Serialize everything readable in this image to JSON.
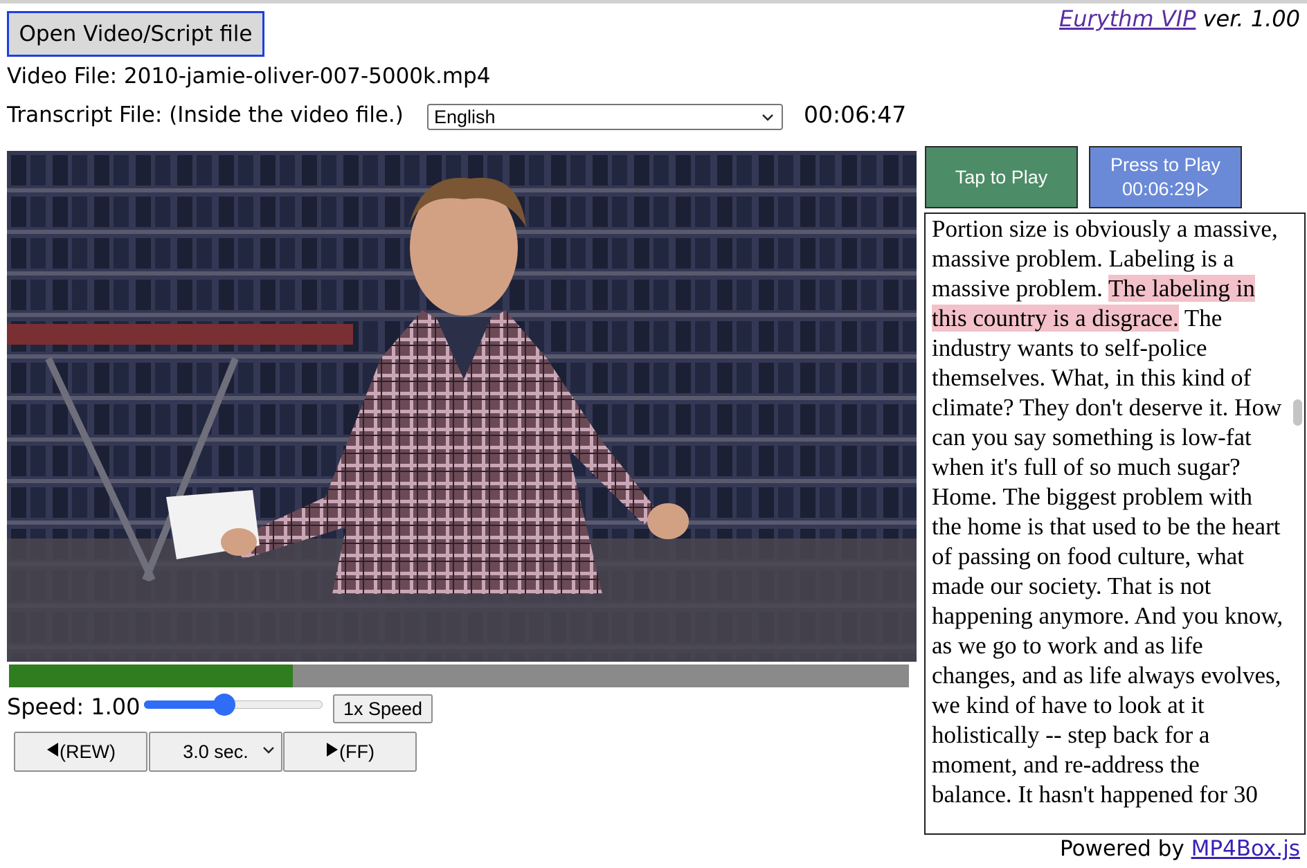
{
  "header": {
    "open_button": "Open Video/Script file",
    "brand_name": "Eurythm VIP",
    "brand_version": "ver. 1.00",
    "video_file_label": "Video File:",
    "video_file_name": "2010-jamie-oliver-007-5000k.mp4",
    "transcript_file_label": "Transcript File:",
    "transcript_file_value": "(Inside the video file.)",
    "language_selected": "English",
    "current_time": "00:06:47"
  },
  "player": {
    "progress_fraction": 0.315,
    "speed_label": "Speed:",
    "speed_value": "1.00",
    "speed_slider_fraction": 0.45,
    "speed_reset_button": "1x Speed",
    "rewind_button": "(REW)",
    "step_selected": "3.0 sec.",
    "fastforward_button": "(FF)"
  },
  "actions": {
    "tap_button": "Tap to Play",
    "press_button_line1": "Press to Play",
    "press_button_time": "00:06:29"
  },
  "transcript": {
    "before": "Portion size is obviously a massive, massive problem. Labeling is a massive problem. ",
    "highlight": "The labeling in this country is a disgrace.",
    "after": " The industry wants to self-police themselves. What, in this kind of climate? They don't deserve it. How can you say something is low-fat when it's full of so much sugar? Home. The biggest problem with the home is that used to be the heart of passing on food culture, what made our society. That is not happening anymore. And you know, as we go to work and as life changes, and as life always evolves, we kind of have to look at it holistically -- step back for a moment, and re-address the balance. It hasn't happened for 30"
  },
  "footer": {
    "powered_by": "Powered by",
    "library": "MP4Box.js"
  },
  "colors": {
    "progress_fill": "#2f7d1f",
    "tap_button_bg": "#4c8c67",
    "press_button_bg": "#6a8ad8",
    "highlight_bg": "#f3c1c9",
    "brand_link": "#5b2ea3"
  },
  "icons": {
    "rewind": "triangle-left-icon",
    "fastforward": "triangle-right-icon",
    "play": "play-outline-icon",
    "dropdown": "chevron-down-icon"
  }
}
